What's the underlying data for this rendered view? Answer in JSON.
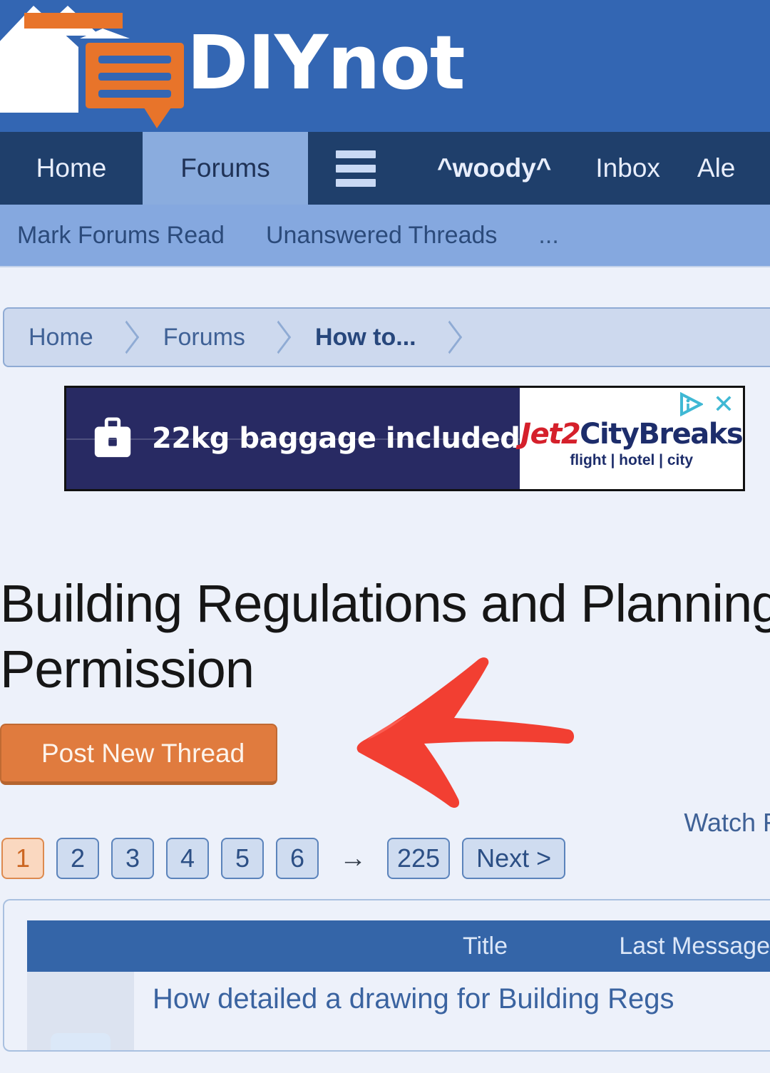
{
  "brand": {
    "name": "DIYnot",
    "logo_icon": "house-speech-bubble-logo"
  },
  "nav_primary": {
    "items": [
      {
        "label": "Home",
        "active": false
      },
      {
        "label": "Forums",
        "active": true
      },
      {
        "label": "",
        "icon": "hamburger-menu-icon",
        "active": false
      },
      {
        "label": "^woody^",
        "active": false
      },
      {
        "label": "Inbox",
        "active": false
      },
      {
        "label": "Ale",
        "active": false
      }
    ]
  },
  "nav_secondary": {
    "items": [
      {
        "label": "Mark Forums Read"
      },
      {
        "label": "Unanswered Threads"
      },
      {
        "label": "..."
      }
    ]
  },
  "breadcrumb": {
    "items": [
      {
        "label": "Home",
        "current": false
      },
      {
        "label": "Forums",
        "current": false
      },
      {
        "label": "How to...",
        "current": true
      }
    ]
  },
  "ad": {
    "headline": "22kg baggage included",
    "icon": "suitcase-icon",
    "brand_part1": "Jet2",
    "brand_part2": "CityBreaks",
    "tagline": "flight | hotel | city",
    "adchoices_icon": "adchoices-triangle-icon",
    "close_icon": "close-x-icon",
    "colors": {
      "left_bg": "#282a63",
      "brand_red": "#d5202b",
      "brand_navy": "#1d2d6b",
      "adchoices_teal": "#3fb8d4"
    }
  },
  "page": {
    "title_line1": "Building Regulations and Planning",
    "title_line2": "Permission"
  },
  "actions": {
    "post_new_thread": "Post New Thread",
    "watch_forum": "Watch F",
    "annotation_icon": "red-arrow-annotation",
    "annotation_color": "#f23f32"
  },
  "pagination": {
    "pages": [
      "1",
      "2",
      "3",
      "4",
      "5",
      "6"
    ],
    "active_page": "1",
    "arrow": "→",
    "last_page": "225",
    "next_label": "Next >"
  },
  "thread_table": {
    "columns": {
      "title": "Title",
      "last_message": "Last Message"
    },
    "rows": [
      {
        "title": "How detailed a drawing for Building Regs"
      }
    ]
  },
  "colors": {
    "header_blue": "#3366b3",
    "nav_dark": "#1f3f6b",
    "nav_active": "#8aacde",
    "subnav_blue": "#85a8df",
    "page_bg": "#edf1fa",
    "accent_orange": "#e07b3e",
    "table_header_blue": "#3465a8",
    "link_blue": "#3a63a0"
  }
}
